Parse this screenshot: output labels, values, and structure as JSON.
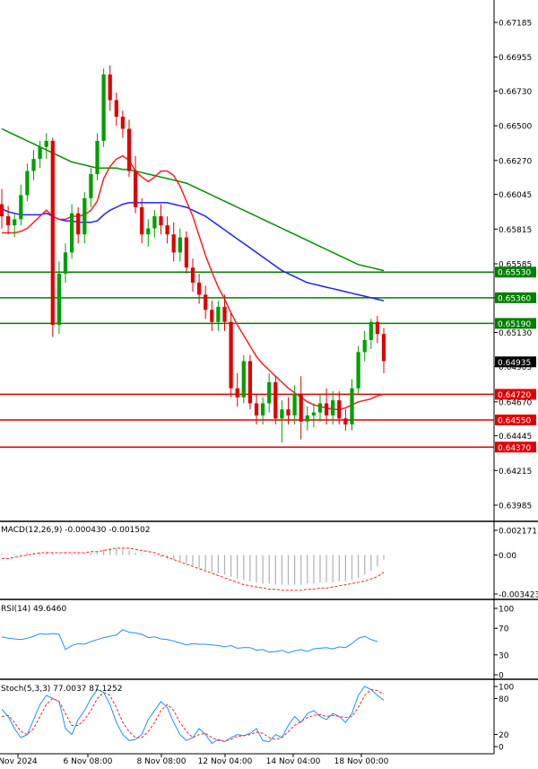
{
  "chart_data": [
    {
      "panel": "price",
      "type": "candlestick",
      "yticks": [
        0.67185,
        0.66955,
        0.6673,
        0.665,
        0.6627,
        0.66045,
        0.65815,
        0.65585,
        0.6536,
        0.6513,
        0.64905,
        0.6467,
        0.64445,
        0.64215,
        0.63985
      ],
      "ytick_labels": [
        "0.67185",
        "0.66955",
        "0.66730",
        "0.66500",
        "0.66270",
        "0.66045",
        "0.65815",
        "0.65585",
        "0.65360",
        "0.65130",
        "0.64905",
        "0.64670",
        "0.64445",
        "0.64215",
        "0.63985"
      ],
      "current_price": {
        "value": 0.64935,
        "label": "0.64935",
        "color": "#000000"
      },
      "levels": [
        {
          "value": 0.6553,
          "label": "0.65530",
          "color": "#008000"
        },
        {
          "value": 0.6536,
          "label": "0.65360",
          "color": "#008000"
        },
        {
          "value": 0.6519,
          "label": "0.65190",
          "color": "#008000"
        },
        {
          "value": 0.6472,
          "label": "0.64720",
          "color": "#e00000"
        },
        {
          "value": 0.6455,
          "label": "0.64550",
          "color": "#e00000"
        },
        {
          "value": 0.6437,
          "label": "0.64370",
          "color": "#e00000"
        }
      ],
      "colors": {
        "up": "#00a000",
        "down": "#e00000",
        "ma_fast": "#ff2020",
        "ma_mid": "#2020ff",
        "ma_slow": "#009000"
      },
      "candles": [
        [
          0.6598,
          0.6608,
          0.6582,
          0.659
        ],
        [
          0.659,
          0.6597,
          0.6578,
          0.6584
        ],
        [
          0.6584,
          0.6592,
          0.6576,
          0.6588
        ],
        [
          0.6588,
          0.6611,
          0.6584,
          0.6604
        ],
        [
          0.6604,
          0.6625,
          0.66,
          0.662
        ],
        [
          0.662,
          0.6634,
          0.6614,
          0.6628
        ],
        [
          0.6628,
          0.664,
          0.6622,
          0.6636
        ],
        [
          0.6636,
          0.6645,
          0.6628,
          0.664
        ],
        [
          0.664,
          0.6642,
          0.651,
          0.6518
        ],
        [
          0.6518,
          0.656,
          0.6512,
          0.6552
        ],
        [
          0.6552,
          0.6572,
          0.6546,
          0.6566
        ],
        [
          0.6566,
          0.6598,
          0.6562,
          0.6592
        ],
        [
          0.6592,
          0.6596,
          0.6572,
          0.6578
        ],
        [
          0.6578,
          0.6606,
          0.6572,
          0.6602
        ],
        [
          0.6602,
          0.6622,
          0.6596,
          0.6618
        ],
        [
          0.6618,
          0.6645,
          0.6614,
          0.664
        ],
        [
          0.664,
          0.6688,
          0.6636,
          0.6684
        ],
        [
          0.6684,
          0.669,
          0.666,
          0.6667
        ],
        [
          0.6667,
          0.6672,
          0.665,
          0.6656
        ],
        [
          0.6656,
          0.666,
          0.6642,
          0.6648
        ],
        [
          0.6648,
          0.6654,
          0.6616,
          0.662
        ],
        [
          0.662,
          0.663,
          0.6592,
          0.6596
        ],
        [
          0.6596,
          0.6602,
          0.6572,
          0.6578
        ],
        [
          0.6578,
          0.6588,
          0.657,
          0.6582
        ],
        [
          0.6582,
          0.6594,
          0.6576,
          0.659
        ],
        [
          0.659,
          0.6598,
          0.6578,
          0.6584
        ],
        [
          0.6584,
          0.659,
          0.6572,
          0.6578
        ],
        [
          0.6578,
          0.6586,
          0.656,
          0.6566
        ],
        [
          0.6566,
          0.6582,
          0.656,
          0.6576
        ],
        [
          0.6576,
          0.658,
          0.6552,
          0.6556
        ],
        [
          0.6556,
          0.6562,
          0.654,
          0.6546
        ],
        [
          0.6546,
          0.6552,
          0.6532,
          0.6538
        ],
        [
          0.6538,
          0.6544,
          0.6522,
          0.6528
        ],
        [
          0.6528,
          0.6534,
          0.6514,
          0.652
        ],
        [
          0.652,
          0.6534,
          0.6514,
          0.653
        ],
        [
          0.653,
          0.6538,
          0.6514,
          0.652
        ],
        [
          0.652,
          0.6526,
          0.647,
          0.6476
        ],
        [
          0.6476,
          0.6486,
          0.6464,
          0.647
        ],
        [
          0.647,
          0.6498,
          0.6466,
          0.6494
        ],
        [
          0.6494,
          0.6498,
          0.6462,
          0.6466
        ],
        [
          0.6466,
          0.6472,
          0.6452,
          0.6458
        ],
        [
          0.6458,
          0.647,
          0.6452,
          0.6466
        ],
        [
          0.6466,
          0.6486,
          0.646,
          0.648
        ],
        [
          0.648,
          0.6484,
          0.6452,
          0.6456
        ],
        [
          0.6456,
          0.6468,
          0.644,
          0.6462
        ],
        [
          0.6462,
          0.647,
          0.6452,
          0.6458
        ],
        [
          0.6458,
          0.6478,
          0.6452,
          0.6472
        ],
        [
          0.6472,
          0.6484,
          0.6442,
          0.6454
        ],
        [
          0.6454,
          0.6464,
          0.6448,
          0.6458
        ],
        [
          0.6458,
          0.6466,
          0.645,
          0.646
        ],
        [
          0.646,
          0.6472,
          0.6454,
          0.6466
        ],
        [
          0.6466,
          0.6476,
          0.6452,
          0.6458
        ],
        [
          0.6458,
          0.6474,
          0.6452,
          0.6468
        ],
        [
          0.6468,
          0.6474,
          0.6452,
          0.6456
        ],
        [
          0.6456,
          0.6462,
          0.6448,
          0.6452
        ],
        [
          0.6452,
          0.6482,
          0.6448,
          0.6476
        ],
        [
          0.6476,
          0.6504,
          0.6472,
          0.65
        ],
        [
          0.65,
          0.6514,
          0.6494,
          0.6508
        ],
        [
          0.6508,
          0.6522,
          0.6502,
          0.652
        ],
        [
          0.652,
          0.6524,
          0.6506,
          0.6512
        ],
        [
          0.6512,
          0.6516,
          0.6486,
          0.6494
        ]
      ],
      "ma_fast": [
        0.6579,
        0.6579,
        0.6579,
        0.658,
        0.6582,
        0.6586,
        0.659,
        0.6594,
        0.659,
        0.6588,
        0.6588,
        0.659,
        0.659,
        0.6591,
        0.6594,
        0.66,
        0.6615,
        0.6623,
        0.6628,
        0.663,
        0.6627,
        0.662,
        0.6616,
        0.6613,
        0.6616,
        0.662,
        0.662,
        0.6617,
        0.661,
        0.66,
        0.659,
        0.6577,
        0.6564,
        0.6553,
        0.6543,
        0.6535,
        0.6526,
        0.6518,
        0.6511,
        0.6504,
        0.6497,
        0.6492,
        0.6488,
        0.6484,
        0.648,
        0.6476,
        0.6473,
        0.647,
        0.6467,
        0.6465,
        0.6464,
        0.6463,
        0.6462,
        0.6462,
        0.6463,
        0.6465,
        0.6467,
        0.6468,
        0.6469,
        0.6471,
        0.6472
      ],
      "ma_mid": [
        0.6595,
        0.6593,
        0.6592,
        0.6591,
        0.6591,
        0.6591,
        0.6591,
        0.6592,
        0.659,
        0.6588,
        0.6587,
        0.6587,
        0.6586,
        0.6586,
        0.6586,
        0.6587,
        0.6591,
        0.6594,
        0.6596,
        0.6598,
        0.6599,
        0.6599,
        0.6599,
        0.6599,
        0.6599,
        0.6599,
        0.6599,
        0.6598,
        0.6597,
        0.6596,
        0.6594,
        0.6592,
        0.659,
        0.6587,
        0.6584,
        0.6581,
        0.6578,
        0.6575,
        0.6572,
        0.6569,
        0.6566,
        0.6563,
        0.656,
        0.6557,
        0.6554,
        0.6552,
        0.655,
        0.6548,
        0.6546,
        0.6545,
        0.6544,
        0.6543,
        0.6542,
        0.6541,
        0.654,
        0.6539,
        0.6538,
        0.6537,
        0.6536,
        0.6535,
        0.6534
      ],
      "ma_slow": [
        0.6648,
        0.6646,
        0.6644,
        0.6642,
        0.664,
        0.6638,
        0.6636,
        0.6634,
        0.6632,
        0.663,
        0.6628,
        0.6626,
        0.6625,
        0.6624,
        0.6623,
        0.6622,
        0.6622,
        0.6622,
        0.6622,
        0.6621,
        0.6621,
        0.662,
        0.6619,
        0.6618,
        0.6617,
        0.6616,
        0.6615,
        0.6614,
        0.6613,
        0.6612,
        0.661,
        0.6608,
        0.6606,
        0.6604,
        0.6602,
        0.66,
        0.6598,
        0.6596,
        0.6594,
        0.6592,
        0.659,
        0.6588,
        0.6586,
        0.6584,
        0.6582,
        0.658,
        0.6578,
        0.6576,
        0.6574,
        0.6572,
        0.657,
        0.6568,
        0.6566,
        0.6564,
        0.6562,
        0.656,
        0.6558,
        0.6557,
        0.6556,
        0.6555,
        0.6554
      ]
    },
    {
      "panel": "macd",
      "type": "bar+line",
      "title": "MACD(12,26,9) -0.000430 -0.001502",
      "yticks": [
        0.002171,
        0.0,
        -0.003423
      ],
      "ytick_labels": [
        "0.002171",
        "0.00",
        "-0.003423"
      ],
      "histogram": [
        0.0001,
        0.0001,
        0.0001,
        0.0001,
        0.0002,
        0.0002,
        0.0002,
        0.0003,
        0.0002,
        0.0001,
        0.0001,
        0.0001,
        0.0001,
        0.0001,
        0.0002,
        0.0003,
        0.0005,
        0.0006,
        0.0006,
        0.0005,
        0.0004,
        0.0002,
        0.0001,
        0.0,
        -0.0001,
        -0.0002,
        -0.0003,
        -0.0004,
        -0.0005,
        -0.0007,
        -0.0009,
        -0.0011,
        -0.0013,
        -0.0015,
        -0.0016,
        -0.0017,
        -0.0019,
        -0.0021,
        -0.0022,
        -0.0023,
        -0.0024,
        -0.0025,
        -0.0025,
        -0.0026,
        -0.0026,
        -0.0026,
        -0.0026,
        -0.0026,
        -0.0025,
        -0.0025,
        -0.0024,
        -0.0024,
        -0.0024,
        -0.0023,
        -0.0023,
        -0.0022,
        -0.002,
        -0.0017,
        -0.0014,
        -0.001,
        -0.0004
      ],
      "signal": [
        -0.0003,
        -0.0003,
        -0.0002,
        -0.0001,
        0.0,
        0.0001,
        0.0002,
        0.0002,
        0.0002,
        0.0002,
        0.0002,
        0.0002,
        0.0002,
        0.0002,
        0.0003,
        0.0003,
        0.0004,
        0.0005,
        0.0006,
        0.0006,
        0.0006,
        0.0005,
        0.0004,
        0.0003,
        0.0002,
        0.0,
        -0.0002,
        -0.0004,
        -0.0006,
        -0.0008,
        -0.001,
        -0.0012,
        -0.0014,
        -0.0016,
        -0.0018,
        -0.002,
        -0.0022,
        -0.0024,
        -0.0026,
        -0.0027,
        -0.0028,
        -0.0029,
        -0.003,
        -0.003,
        -0.0031,
        -0.0031,
        -0.0031,
        -0.0031,
        -0.003,
        -0.003,
        -0.0029,
        -0.0029,
        -0.0028,
        -0.0027,
        -0.0026,
        -0.0025,
        -0.0024,
        -0.0023,
        -0.0021,
        -0.0019,
        -0.0015
      ]
    },
    {
      "panel": "rsi",
      "type": "line",
      "title": "RSI(14) 49.6460",
      "yticks": [
        100,
        70,
        30,
        0
      ],
      "ytick_labels": [
        "100",
        "70",
        "30",
        "0"
      ],
      "values": [
        57,
        55,
        54,
        53,
        55,
        58,
        62,
        61,
        62,
        61,
        38,
        44,
        47,
        46,
        50,
        53,
        56,
        58,
        60,
        68,
        64,
        63,
        61,
        56,
        57,
        54,
        53,
        51,
        48,
        45,
        47,
        46,
        46,
        45,
        44,
        42,
        44,
        40,
        41,
        41,
        37,
        38,
        34,
        35,
        37,
        33,
        36,
        38,
        35,
        39,
        40,
        41,
        39,
        42,
        41,
        47,
        55,
        58,
        53,
        50
      ]
    },
    {
      "panel": "stoch",
      "type": "line",
      "title": "Stoch(5,3,3) 77.0037 87.1252",
      "yticks": [
        100,
        80,
        20,
        0
      ],
      "ytick_labels": [
        "100",
        "80",
        "20",
        "0"
      ],
      "k": [
        62,
        50,
        30,
        15,
        20,
        45,
        70,
        85,
        80,
        75,
        30,
        20,
        45,
        60,
        80,
        95,
        90,
        70,
        40,
        20,
        10,
        12,
        20,
        45,
        60,
        75,
        65,
        40,
        20,
        10,
        15,
        30,
        20,
        5,
        12,
        8,
        15,
        20,
        18,
        22,
        30,
        10,
        8,
        20,
        15,
        35,
        50,
        40,
        55,
        60,
        50,
        45,
        55,
        50,
        40,
        55,
        85,
        100,
        95,
        85,
        77
      ],
      "d": [
        50,
        52,
        40,
        25,
        20,
        30,
        50,
        70,
        80,
        75,
        55,
        35,
        35,
        45,
        60,
        80,
        90,
        85,
        65,
        40,
        25,
        15,
        15,
        25,
        40,
        60,
        70,
        60,
        40,
        25,
        15,
        20,
        22,
        15,
        10,
        9,
        12,
        17,
        18,
        20,
        24,
        22,
        15,
        12,
        15,
        25,
        35,
        42,
        48,
        52,
        53,
        50,
        52,
        50,
        48,
        50,
        65,
        85,
        95,
        93,
        87
      ]
    }
  ],
  "xaxis": {
    "tick_labels": [
      "Nov 2024",
      "6 Nov 08:00",
      "8 Nov 08:00",
      "12 Nov 04:00",
      "14 Nov 04:00",
      "18 Nov 00:00"
    ]
  }
}
